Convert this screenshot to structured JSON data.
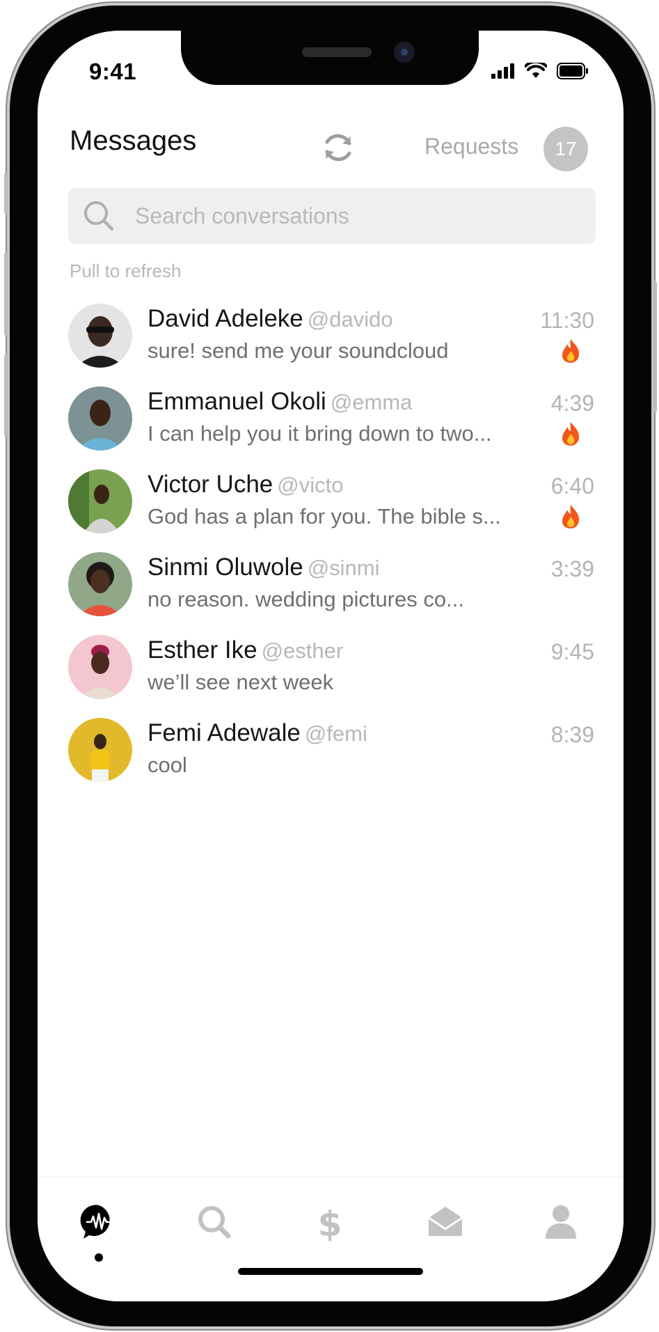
{
  "status": {
    "time": "9:41"
  },
  "header": {
    "title": "Messages",
    "requests_label": "Requests",
    "requests_count": "17"
  },
  "search": {
    "placeholder": "Search conversations"
  },
  "pull_hint": "Pull to refresh",
  "conversations": [
    {
      "name": "David Adeleke",
      "handle": "@davido",
      "message": "sure! send me your soundcloud",
      "time": "11:30",
      "fire": true,
      "avatar_color": "#d9d9d9"
    },
    {
      "name": "Emmanuel Okoli",
      "handle": "@emma",
      "message": "I can help you it bring down to two...",
      "time": "4:39",
      "fire": true,
      "avatar_color": "#6f8a8c"
    },
    {
      "name": "Victor Uche",
      "handle": "@victo",
      "message": "God has a plan for you. The bible s...",
      "time": "6:40",
      "fire": true,
      "avatar_color": "#7fa35a"
    },
    {
      "name": "Sinmi Oluwole",
      "handle": "@sinmi",
      "message": "no reason. wedding pictures co...",
      "time": "3:39",
      "fire": false,
      "avatar_color": "#8fa585"
    },
    {
      "name": "Esther Ike",
      "handle": "@esther",
      "message": "we’ll see next week",
      "time": "9:45",
      "fire": false,
      "avatar_color": "#f2c4cd"
    },
    {
      "name": "Femi Adewale",
      "handle": "@femi",
      "message": "cool",
      "time": "8:39",
      "fire": false,
      "avatar_color": "#e0b52a"
    }
  ],
  "tabbar": {
    "items": [
      "feed-icon",
      "search-icon",
      "dollar-icon",
      "mail-icon",
      "profile-icon"
    ],
    "active": "feed-icon"
  },
  "colors": {
    "accent": "#000000",
    "muted": "#b4b4b4",
    "badge": "#c4c4c4"
  }
}
